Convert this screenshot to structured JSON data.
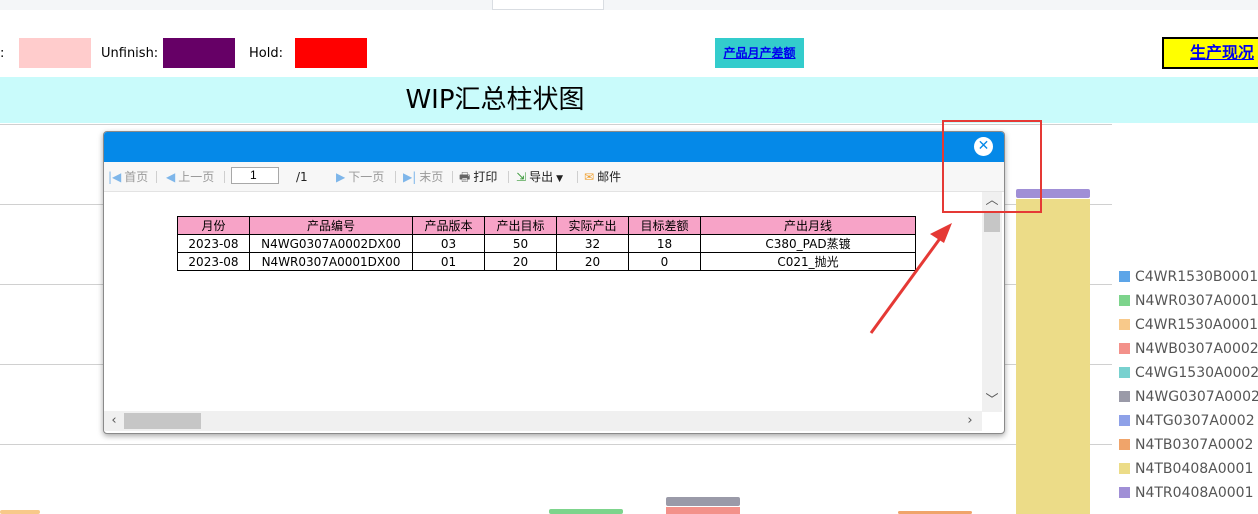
{
  "status_legend": {
    "items": [
      {
        "label": ":",
        "color": "#ffcccc"
      },
      {
        "label": "Unfinish:",
        "color": "#660066"
      },
      {
        "label": "Hold:",
        "color": "#ff0000"
      }
    ]
  },
  "links": {
    "diff_link": "产品月产差额",
    "production_status": "生产现况"
  },
  "page_title": "WIP汇总柱状图",
  "series_legend": [
    {
      "name": "C4WR1530B0001",
      "color": "#5da5e8"
    },
    {
      "name": "N4WR0307A0001",
      "color": "#7dd48c"
    },
    {
      "name": "C4WR1530A0001",
      "color": "#f8c98a"
    },
    {
      "name": "N4WB0307A0002",
      "color": "#f3918a"
    },
    {
      "name": "C4WG1530A0002",
      "color": "#78d1cf"
    },
    {
      "name": "N4WG0307A0002",
      "color": "#9a9aa8"
    },
    {
      "name": "N4TG0307A0002",
      "color": "#8ea1e8"
    },
    {
      "name": "N4TB0307A0002",
      "color": "#f0a46a"
    },
    {
      "name": "N4TB0408A0001",
      "color": "#ecdc88"
    },
    {
      "name": "N4TR0408A0001",
      "color": "#a08fd6"
    }
  ],
  "dialog": {
    "toolbar": {
      "first": "首页",
      "prev": "上一页",
      "page_value": "1",
      "page_total": "/1",
      "next": "下一页",
      "last": "末页",
      "print": "打印",
      "export": "导出",
      "mail": "邮件"
    },
    "table": {
      "headers": [
        "月份",
        "产品编号",
        "产品版本",
        "产出目标",
        "实际产出",
        "目标差额",
        "产出月线"
      ],
      "rows": [
        [
          "2023-08",
          "N4WG0307A0002DX00",
          "03",
          "50",
          "32",
          "18",
          "C380_PAD蒸镀"
        ],
        [
          "2023-08",
          "N4WR0307A0001DX00",
          "01",
          "20",
          "20",
          "0",
          "C021_抛光"
        ]
      ]
    }
  }
}
